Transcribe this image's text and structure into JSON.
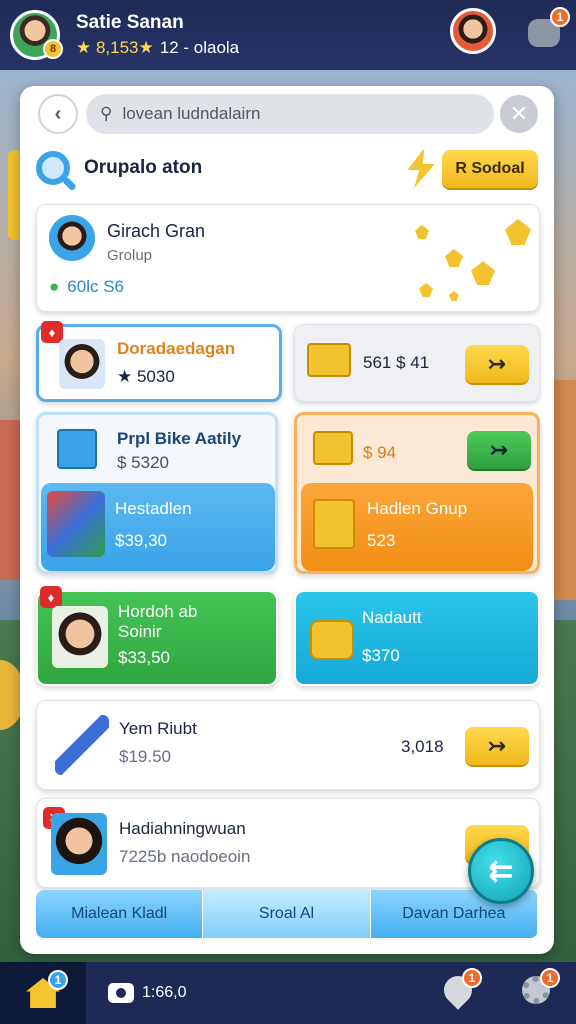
{
  "header": {
    "player_name": "Satie Sanan",
    "level_badge": "8",
    "star_score": "★ 8,153★",
    "stat_text": "12 - olaola",
    "robot_badge": "1"
  },
  "search": {
    "placeholder": "lovean ludndalairn"
  },
  "section": {
    "title": "Orupalo aton",
    "select_label": "R Sodoal"
  },
  "group": {
    "name": "Girach Gran",
    "sub": "Grolup",
    "stat": "60lc S6"
  },
  "items": [
    {
      "name": "Doradaedagan",
      "price": "★ 5030",
      "tag": "♦"
    },
    {
      "price": "561 $ 41",
      "button": "↣"
    },
    {
      "name": "Prpl Bike Aatily",
      "price": "$ 5320"
    },
    {
      "price": "$ 94",
      "button": "↣"
    },
    {
      "name": "Hestadlen",
      "price": "$39,30"
    },
    {
      "name": "Hadlen Gnup",
      "price": "523"
    },
    {
      "name": "Hordoh ab Soinir",
      "price": "$33,50",
      "tag": "♦"
    },
    {
      "name": "Nadautt",
      "price": "$370"
    },
    {
      "name": "Yem Riubt",
      "price": "$19.50",
      "value": "3,018",
      "button": "↣"
    },
    {
      "name": "Hadiahningwuan",
      "price": "7225b naodoeoin",
      "tag": "✕",
      "button": "↣"
    }
  ],
  "tabs": [
    "Mialean Kladl",
    "Sroal Al",
    "Davan Darhea"
  ],
  "fab": "⇇",
  "nav": {
    "coins": "1:66,0",
    "home_badge": "1",
    "chat_badge": "1",
    "settings_badge": "1"
  },
  "colors": {
    "accent_blue": "#43aef0",
    "accent_yellow": "#f4c430",
    "accent_orange": "#f79a1e",
    "accent_green": "#3cb84a",
    "accent_cyan": "#1fb8e0"
  }
}
